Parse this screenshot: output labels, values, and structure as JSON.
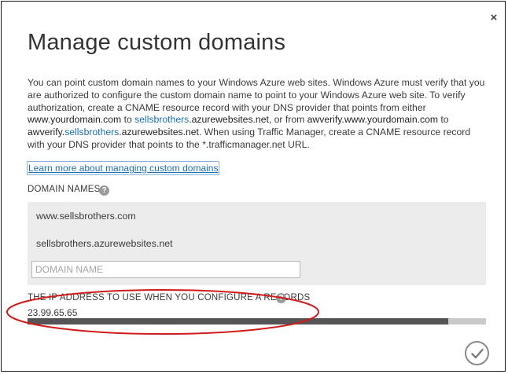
{
  "dialog": {
    "close_glyph": "×",
    "title": "Manage custom domains",
    "description": {
      "p1": "You can point custom domain names to your Windows Azure web sites. Windows Azure must verify that you are authorized to configure the custom domain name to point to your Windows Azure web site. To verify authorization, create a CNAME resource record with your DNS provider that points from either ",
      "d1": "www.yourdomain.com",
      "p2": " to ",
      "l1": "sellsbrothers",
      "d2": ".azurewebsites.net",
      "p3": ", or from ",
      "d3": "awverify.www.yourdomain.com",
      "p4": " to ",
      "d4": "awverify.",
      "l2": "sellsbrothers",
      "d5": ".azurewebsites.net",
      "p5": ". When using Traffic Manager, create a CNAME resource record with your DNS provider that points to the *.trafficmanager.net URL."
    },
    "learn_more_link": "Learn more about managing custom domains",
    "domain_names_label": "DOMAIN NAMES",
    "help_glyph": "?",
    "domains": [
      "www.sellsbrothers.com",
      "sellsbrothers.azurewebsites.net"
    ],
    "domain_input": {
      "placeholder": "DOMAIN NAME",
      "value": ""
    },
    "ip_label": "THE IP ADDRESS TO USE WHEN YOU CONFIGURE A RECORDS",
    "ip_address": "23.99.65.65",
    "progress_fraction": 0.918,
    "colors": {
      "link": "#1b6fb3",
      "annotation": "#d11a1a",
      "row_background": "#ececec",
      "progress_fill": "#555555",
      "progress_track": "#c9c9c9"
    },
    "icons": {
      "close": "close-icon",
      "help": "question-mark-icon",
      "confirm": "checkmark-icon"
    }
  }
}
